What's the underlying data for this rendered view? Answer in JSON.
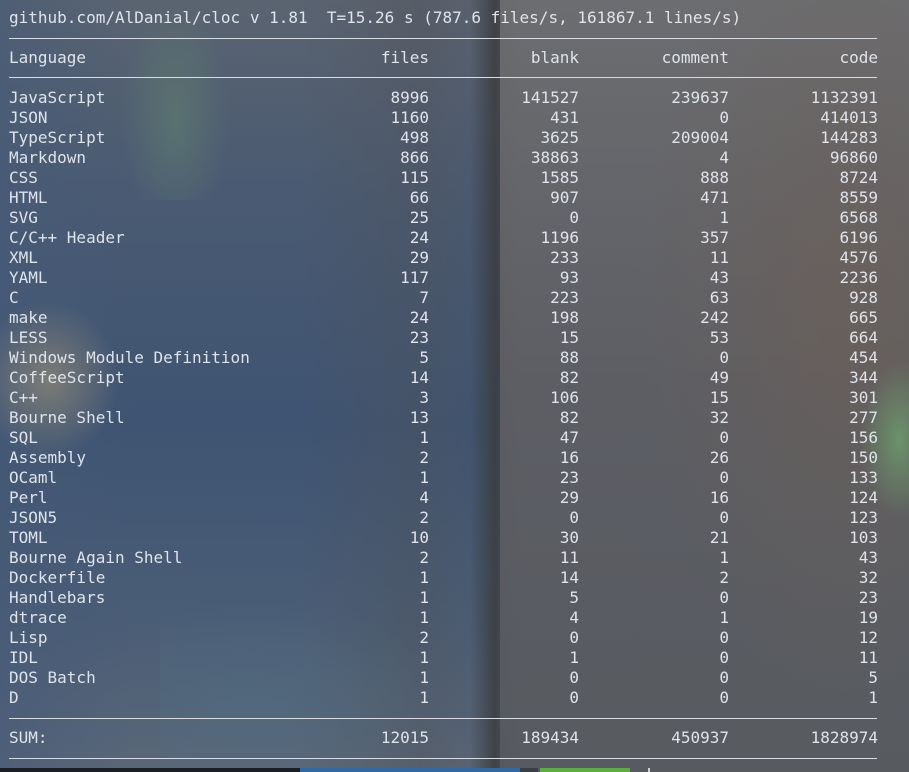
{
  "header": {
    "title": "github.com/AlDanial/cloc v 1.81  T=15.26 s (787.6 files/s, 161867.1 lines/s)"
  },
  "table": {
    "columns": [
      "Language",
      "files",
      "blank",
      "comment",
      "code"
    ],
    "rows": [
      [
        "JavaScript",
        "8996",
        "141527",
        "239637",
        "1132391"
      ],
      [
        "JSON",
        "1160",
        "431",
        "0",
        "414013"
      ],
      [
        "TypeScript",
        "498",
        "3625",
        "209004",
        "144283"
      ],
      [
        "Markdown",
        "866",
        "38863",
        "4",
        "96860"
      ],
      [
        "CSS",
        "115",
        "1585",
        "888",
        "8724"
      ],
      [
        "HTML",
        "66",
        "907",
        "471",
        "8559"
      ],
      [
        "SVG",
        "25",
        "0",
        "1",
        "6568"
      ],
      [
        "C/C++ Header",
        "24",
        "1196",
        "357",
        "6196"
      ],
      [
        "XML",
        "29",
        "233",
        "11",
        "4576"
      ],
      [
        "YAML",
        "117",
        "93",
        "43",
        "2236"
      ],
      [
        "C",
        "7",
        "223",
        "63",
        "928"
      ],
      [
        "make",
        "24",
        "198",
        "242",
        "665"
      ],
      [
        "LESS",
        "23",
        "15",
        "53",
        "664"
      ],
      [
        "Windows Module Definition",
        "5",
        "88",
        "0",
        "454"
      ],
      [
        "CoffeeScript",
        "14",
        "82",
        "49",
        "344"
      ],
      [
        "C++",
        "3",
        "106",
        "15",
        "301"
      ],
      [
        "Bourne Shell",
        "13",
        "82",
        "32",
        "277"
      ],
      [
        "SQL",
        "1",
        "47",
        "0",
        "156"
      ],
      [
        "Assembly",
        "2",
        "16",
        "26",
        "150"
      ],
      [
        "OCaml",
        "1",
        "23",
        "0",
        "133"
      ],
      [
        "Perl",
        "4",
        "29",
        "16",
        "124"
      ],
      [
        "JSON5",
        "2",
        "0",
        "0",
        "123"
      ],
      [
        "TOML",
        "10",
        "30",
        "21",
        "103"
      ],
      [
        "Bourne Again Shell",
        "2",
        "11",
        "1",
        "43"
      ],
      [
        "Dockerfile",
        "1",
        "14",
        "2",
        "32"
      ],
      [
        "Handlebars",
        "1",
        "5",
        "0",
        "23"
      ],
      [
        "dtrace",
        "1",
        "4",
        "1",
        "19"
      ],
      [
        "Lisp",
        "2",
        "0",
        "0",
        "12"
      ],
      [
        "IDL",
        "1",
        "1",
        "0",
        "11"
      ],
      [
        "DOS Batch",
        "1",
        "0",
        "0",
        "5"
      ],
      [
        "D",
        "1",
        "0",
        "0",
        "1"
      ]
    ],
    "sum": [
      "SUM:",
      "12015",
      "189434",
      "450937",
      "1828974"
    ]
  },
  "colors": {
    "text": "#dfe3ea",
    "rule": "#d8dce3",
    "statusbar_blue": "#2f6aa8",
    "statusbar_green": "#59b03a"
  }
}
